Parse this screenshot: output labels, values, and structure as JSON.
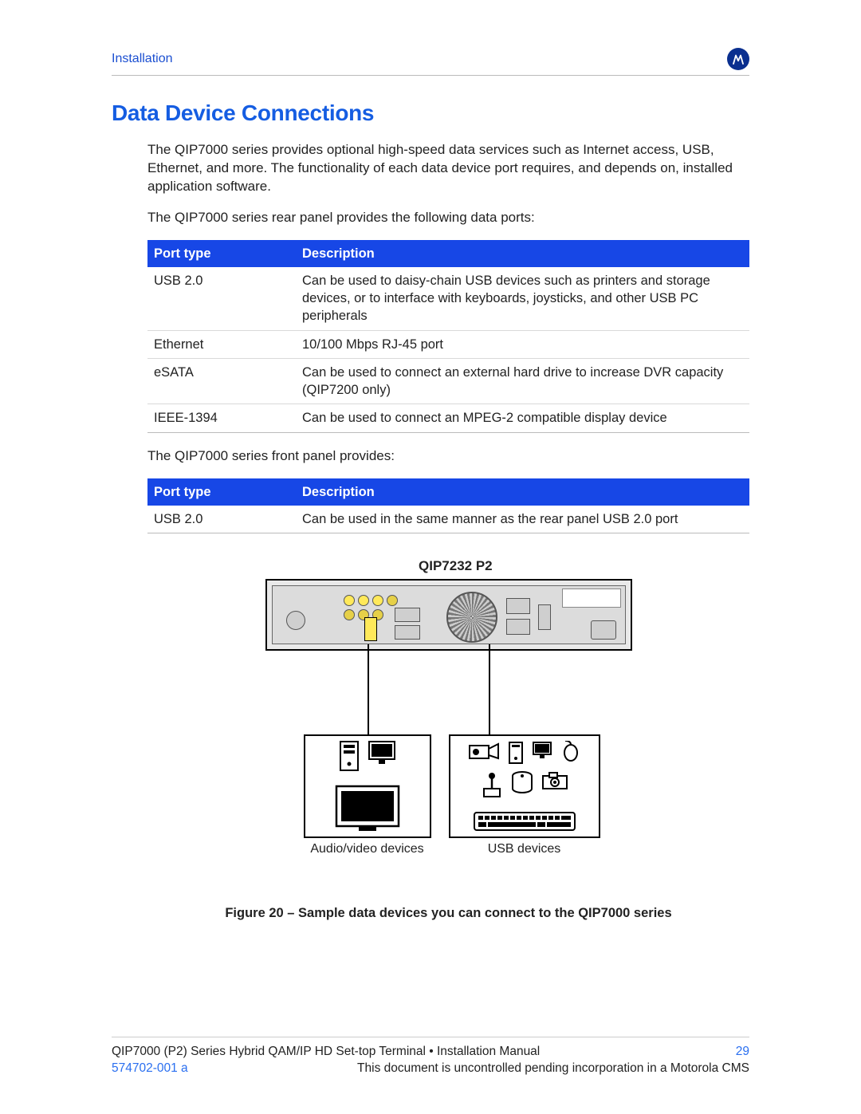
{
  "header": {
    "section": "Installation"
  },
  "title": "Data Device Connections",
  "intro_p1": "The QIP7000 series provides optional high-speed data services such as Internet access, USB, Ethernet, and more. The functionality of each data device port requires, and depends on, installed application software.",
  "intro_p2": "The QIP7000 series rear panel provides the following data ports:",
  "table_rear": {
    "headers": [
      "Port type",
      "Description"
    ],
    "rows": [
      {
        "port": "USB 2.0",
        "desc": "Can be used to daisy-chain USB devices such as printers and storage devices, or to interface with keyboards, joysticks, and other USB PC peripherals"
      },
      {
        "port": "Ethernet",
        "desc": "10/100 Mbps RJ-45 port"
      },
      {
        "port": "eSATA",
        "desc": "Can be used to connect an external hard drive to increase DVR capacity (QIP7200 only)"
      },
      {
        "port": "IEEE-1394",
        "desc": "Can be used to connect an MPEG-2 compatible display device"
      }
    ]
  },
  "front_intro": "The QIP7000 series front panel provides:",
  "table_front": {
    "headers": [
      "Port type",
      "Description"
    ],
    "rows": [
      {
        "port": "USB 2.0",
        "desc": "Can be used in the same manner as the rear panel USB 2.0 port"
      }
    ]
  },
  "figure": {
    "model": "QIP7232 P2",
    "left_caption": "Audio/video devices",
    "right_caption": "USB devices",
    "caption": "Figure 20 – Sample data devices you can connect to the QIP7000 series"
  },
  "footer": {
    "line1_left": "QIP7000 (P2) Series Hybrid QAM/IP HD Set-top Terminal • Installation Manual",
    "page_no": "29",
    "doc_no": "574702-001 a",
    "line2_right": "This document is uncontrolled pending incorporation in a Motorola CMS"
  }
}
